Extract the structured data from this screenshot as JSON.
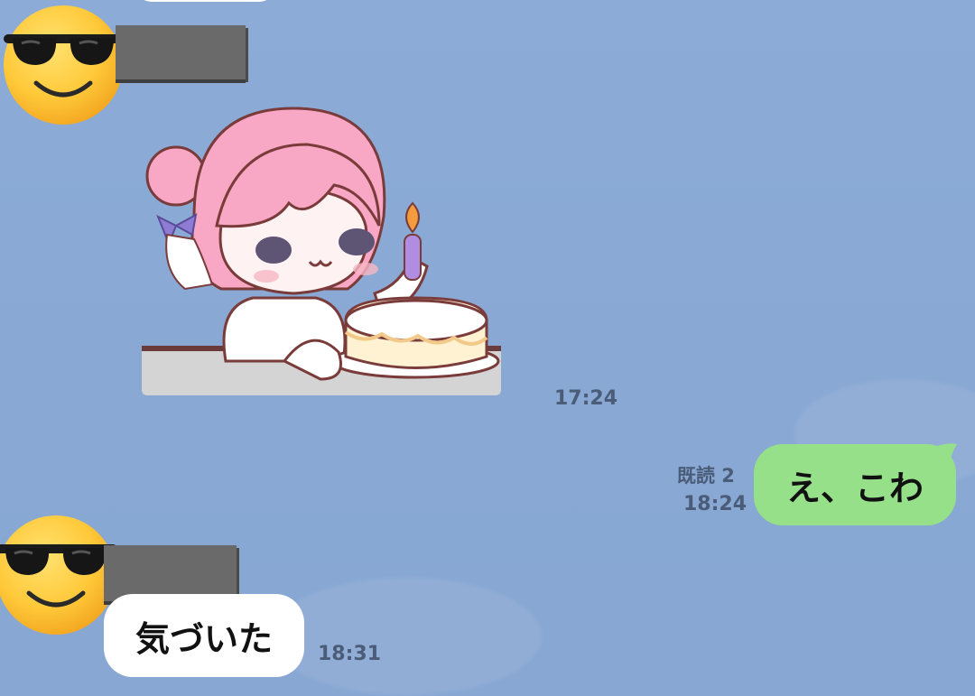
{
  "chat": {
    "messages": [
      {
        "type": "sticker",
        "direction": "incoming",
        "time": "17:24"
      },
      {
        "type": "text",
        "direction": "outgoing",
        "text": "え、こわ",
        "read_status": "既読 2",
        "time": "18:24"
      },
      {
        "type": "text",
        "direction": "incoming",
        "text": "気づいた",
        "time": "18:31"
      }
    ]
  },
  "colors": {
    "background": "#89A8D5",
    "outgoing_bubble": "#96E08A",
    "incoming_bubble": "#FFFFFF",
    "meta_text": "#4B5C78",
    "redaction": "#6A6A6A"
  },
  "icons": {
    "avatar": "smiling-face-with-sunglasses-icon"
  }
}
